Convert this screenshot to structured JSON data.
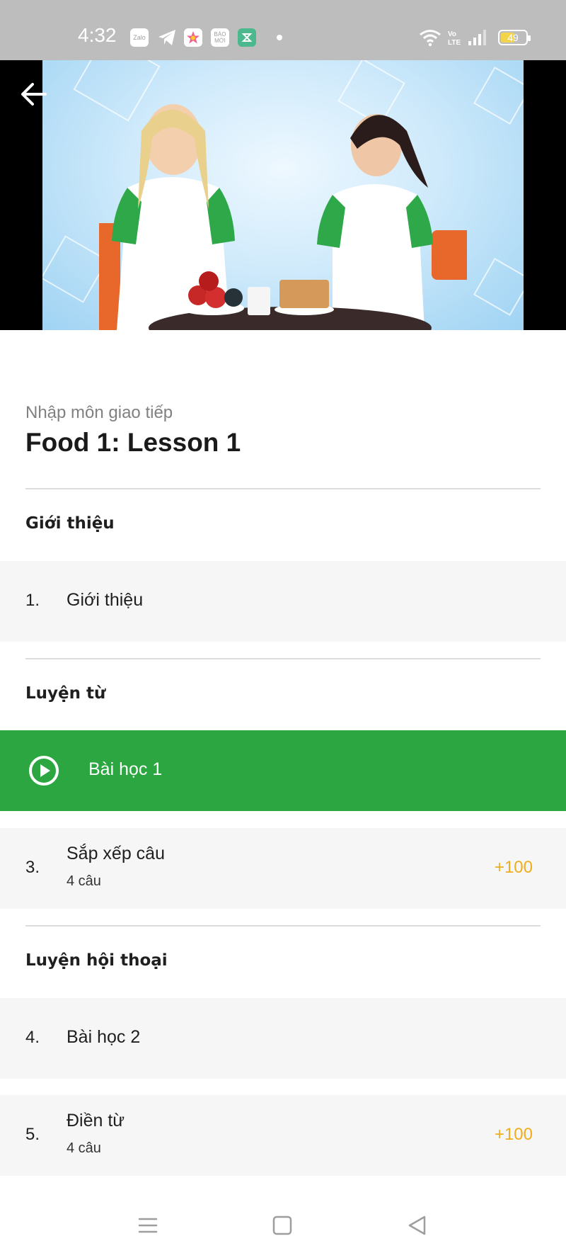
{
  "status_bar": {
    "time": "4:32",
    "app_badges": [
      "Zalo",
      "BÁO MỚI"
    ],
    "battery_level": "49",
    "battery_fraction": 0.49,
    "icons": [
      "zalo-icon",
      "telegram-icon",
      "photos-icon",
      "baomoi-icon",
      "app-icon",
      "wifi-icon",
      "volte-icon",
      "signal-icon",
      "battery-icon"
    ]
  },
  "video": {
    "back_icon": "arrow-left-icon"
  },
  "lesson": {
    "course_name": "Nhập môn giao tiếp",
    "title": "Food 1: Lesson 1"
  },
  "sections": [
    {
      "title": "Giới thiệu",
      "items": [
        {
          "num": "1.",
          "label": "Giới thiệu"
        }
      ]
    },
    {
      "title": "Luyện từ",
      "items": [
        {
          "label": "Bài học 1",
          "active": true,
          "icon": "play-circle-icon"
        },
        {
          "num": "3.",
          "label": "Sắp xếp câu",
          "sub": "4 câu",
          "points": "+100"
        }
      ]
    },
    {
      "title": "Luyện hội thoại",
      "items": [
        {
          "num": "4.",
          "label": "Bài học 2"
        },
        {
          "num": "5.",
          "label": "Điền từ",
          "sub": "4 câu",
          "points": "+100"
        }
      ]
    }
  ],
  "colors": {
    "accent_green": "#2ba640",
    "points_gold": "#f0ad1e",
    "status_bar_gray": "#bdbdbd"
  },
  "navbar": {
    "icons": [
      "menu-icon",
      "home-square-icon",
      "back-triangle-icon"
    ]
  }
}
